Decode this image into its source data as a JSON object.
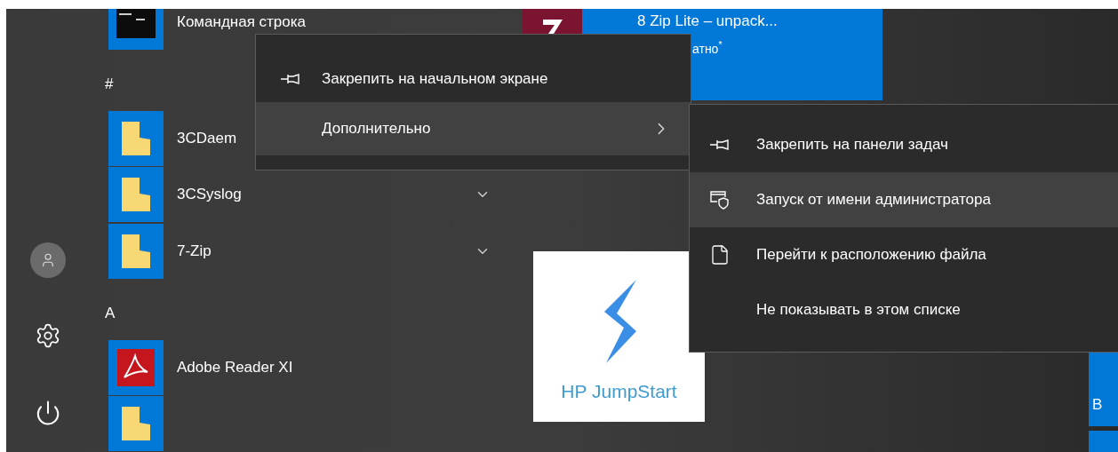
{
  "rail": [
    {
      "kind": "avatar"
    },
    {
      "kind": "settings"
    },
    {
      "kind": "power"
    }
  ],
  "app_list": [
    {
      "kind": "terminal",
      "name": "Командная строка",
      "expandable": false
    },
    {
      "kind": "header",
      "label": "#"
    },
    {
      "kind": "folder",
      "name": "3CDaem"
    },
    {
      "kind": "folder",
      "name": "3CSyslog",
      "expandable": true
    },
    {
      "kind": "folder",
      "name": "7-Zip",
      "expandable": true
    },
    {
      "kind": "header",
      "label": "A"
    },
    {
      "kind": "pdf",
      "name": "Adobe Reader XI",
      "expandable": false
    },
    {
      "kind": "folder",
      "expandable": false
    }
  ],
  "tiles": {
    "store_tile": {
      "title": "8 Zip Lite – unpack...",
      "subtitle": "атно$^{*}$"
    },
    "jumpstart_tile": {
      "label": "HP JumpStart"
    },
    "edge_tile": {
      "label": "B"
    }
  },
  "context_menu": {
    "items": [
      {
        "label": "Закрепить на начальном экране",
        "kind": "pin",
        "selected": false,
        "submenu": false
      },
      {
        "label": "Дополнительно",
        "kind": "plain",
        "selected": true,
        "submenu": true
      }
    ]
  },
  "submenu": {
    "items": [
      {
        "label": "Закрепить на панели задач",
        "kind": "pin",
        "selected": false
      },
      {
        "label": "Запуск от имени администратора",
        "kind": "admin",
        "selected": true
      },
      {
        "label": "Перейти к расположению файла",
        "kind": "file",
        "selected": false
      },
      {
        "label": "Не показывать в этом списке",
        "kind": "plain",
        "selected": false
      }
    ]
  }
}
